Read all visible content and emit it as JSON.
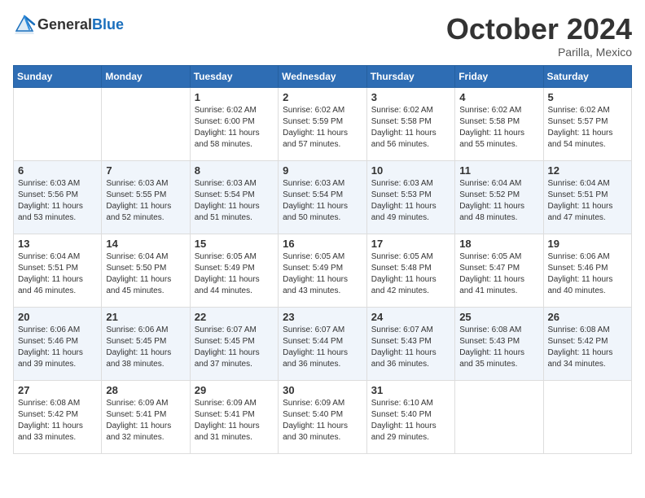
{
  "header": {
    "logo_general": "General",
    "logo_blue": "Blue",
    "month_title": "October 2024",
    "location": "Parilla, Mexico"
  },
  "weekdays": [
    "Sunday",
    "Monday",
    "Tuesday",
    "Wednesday",
    "Thursday",
    "Friday",
    "Saturday"
  ],
  "weeks": [
    [
      {
        "day": "",
        "content": ""
      },
      {
        "day": "",
        "content": ""
      },
      {
        "day": "1",
        "content": "Sunrise: 6:02 AM\nSunset: 6:00 PM\nDaylight: 11 hours and 58 minutes."
      },
      {
        "day": "2",
        "content": "Sunrise: 6:02 AM\nSunset: 5:59 PM\nDaylight: 11 hours and 57 minutes."
      },
      {
        "day": "3",
        "content": "Sunrise: 6:02 AM\nSunset: 5:58 PM\nDaylight: 11 hours and 56 minutes."
      },
      {
        "day": "4",
        "content": "Sunrise: 6:02 AM\nSunset: 5:58 PM\nDaylight: 11 hours and 55 minutes."
      },
      {
        "day": "5",
        "content": "Sunrise: 6:02 AM\nSunset: 5:57 PM\nDaylight: 11 hours and 54 minutes."
      }
    ],
    [
      {
        "day": "6",
        "content": "Sunrise: 6:03 AM\nSunset: 5:56 PM\nDaylight: 11 hours and 53 minutes."
      },
      {
        "day": "7",
        "content": "Sunrise: 6:03 AM\nSunset: 5:55 PM\nDaylight: 11 hours and 52 minutes."
      },
      {
        "day": "8",
        "content": "Sunrise: 6:03 AM\nSunset: 5:54 PM\nDaylight: 11 hours and 51 minutes."
      },
      {
        "day": "9",
        "content": "Sunrise: 6:03 AM\nSunset: 5:54 PM\nDaylight: 11 hours and 50 minutes."
      },
      {
        "day": "10",
        "content": "Sunrise: 6:03 AM\nSunset: 5:53 PM\nDaylight: 11 hours and 49 minutes."
      },
      {
        "day": "11",
        "content": "Sunrise: 6:04 AM\nSunset: 5:52 PM\nDaylight: 11 hours and 48 minutes."
      },
      {
        "day": "12",
        "content": "Sunrise: 6:04 AM\nSunset: 5:51 PM\nDaylight: 11 hours and 47 minutes."
      }
    ],
    [
      {
        "day": "13",
        "content": "Sunrise: 6:04 AM\nSunset: 5:51 PM\nDaylight: 11 hours and 46 minutes."
      },
      {
        "day": "14",
        "content": "Sunrise: 6:04 AM\nSunset: 5:50 PM\nDaylight: 11 hours and 45 minutes."
      },
      {
        "day": "15",
        "content": "Sunrise: 6:05 AM\nSunset: 5:49 PM\nDaylight: 11 hours and 44 minutes."
      },
      {
        "day": "16",
        "content": "Sunrise: 6:05 AM\nSunset: 5:49 PM\nDaylight: 11 hours and 43 minutes."
      },
      {
        "day": "17",
        "content": "Sunrise: 6:05 AM\nSunset: 5:48 PM\nDaylight: 11 hours and 42 minutes."
      },
      {
        "day": "18",
        "content": "Sunrise: 6:05 AM\nSunset: 5:47 PM\nDaylight: 11 hours and 41 minutes."
      },
      {
        "day": "19",
        "content": "Sunrise: 6:06 AM\nSunset: 5:46 PM\nDaylight: 11 hours and 40 minutes."
      }
    ],
    [
      {
        "day": "20",
        "content": "Sunrise: 6:06 AM\nSunset: 5:46 PM\nDaylight: 11 hours and 39 minutes."
      },
      {
        "day": "21",
        "content": "Sunrise: 6:06 AM\nSunset: 5:45 PM\nDaylight: 11 hours and 38 minutes."
      },
      {
        "day": "22",
        "content": "Sunrise: 6:07 AM\nSunset: 5:45 PM\nDaylight: 11 hours and 37 minutes."
      },
      {
        "day": "23",
        "content": "Sunrise: 6:07 AM\nSunset: 5:44 PM\nDaylight: 11 hours and 36 minutes."
      },
      {
        "day": "24",
        "content": "Sunrise: 6:07 AM\nSunset: 5:43 PM\nDaylight: 11 hours and 36 minutes."
      },
      {
        "day": "25",
        "content": "Sunrise: 6:08 AM\nSunset: 5:43 PM\nDaylight: 11 hours and 35 minutes."
      },
      {
        "day": "26",
        "content": "Sunrise: 6:08 AM\nSunset: 5:42 PM\nDaylight: 11 hours and 34 minutes."
      }
    ],
    [
      {
        "day": "27",
        "content": "Sunrise: 6:08 AM\nSunset: 5:42 PM\nDaylight: 11 hours and 33 minutes."
      },
      {
        "day": "28",
        "content": "Sunrise: 6:09 AM\nSunset: 5:41 PM\nDaylight: 11 hours and 32 minutes."
      },
      {
        "day": "29",
        "content": "Sunrise: 6:09 AM\nSunset: 5:41 PM\nDaylight: 11 hours and 31 minutes."
      },
      {
        "day": "30",
        "content": "Sunrise: 6:09 AM\nSunset: 5:40 PM\nDaylight: 11 hours and 30 minutes."
      },
      {
        "day": "31",
        "content": "Sunrise: 6:10 AM\nSunset: 5:40 PM\nDaylight: 11 hours and 29 minutes."
      },
      {
        "day": "",
        "content": ""
      },
      {
        "day": "",
        "content": ""
      }
    ]
  ]
}
